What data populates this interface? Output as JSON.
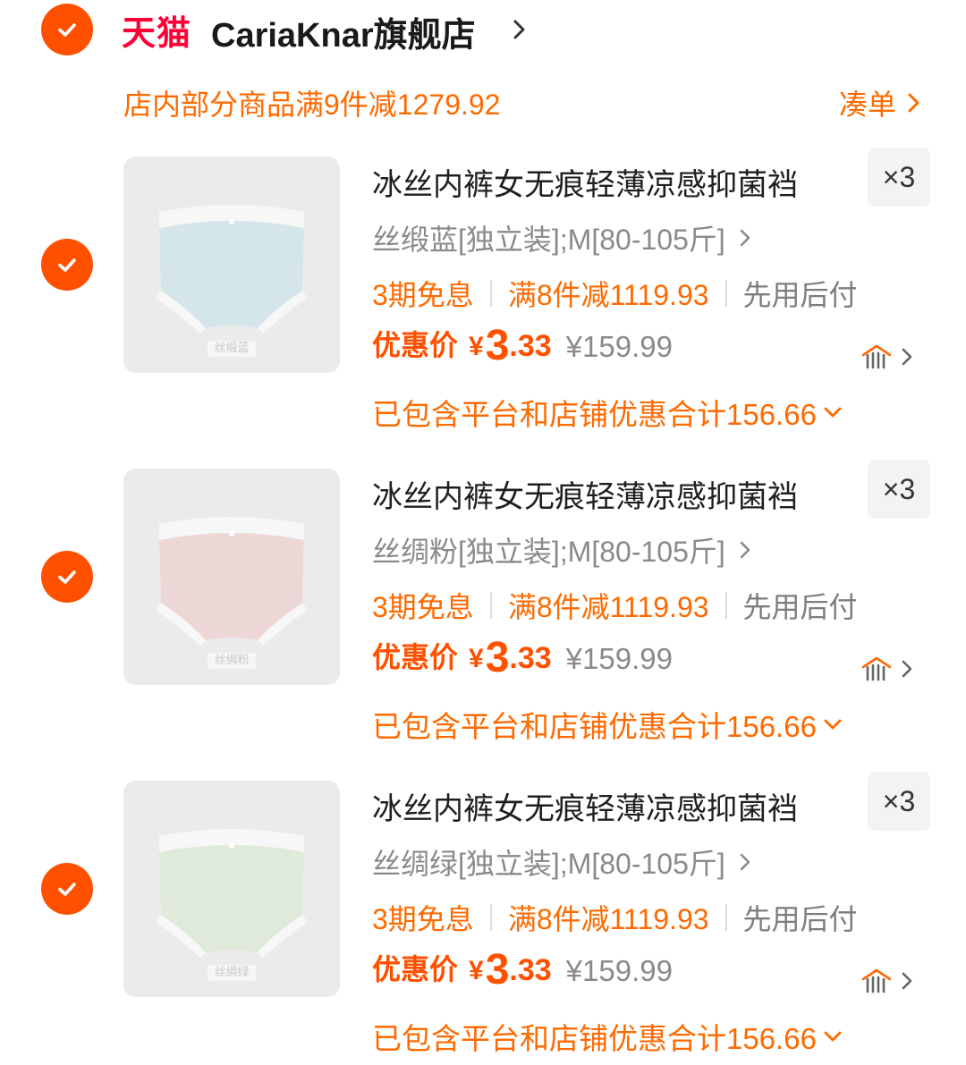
{
  "store": {
    "logo_text": "天猫",
    "name": "CariaKnar旗舰店",
    "promo": "店内部分商品满9件减1279.92",
    "coudan_label": "凑单"
  },
  "colors": {
    "accent": "#ff5000",
    "promo_orange": "#ff6a00",
    "tmall_red": "#ff0036",
    "gray_text": "#8a8a8a"
  },
  "items": [
    {
      "title": "冰丝内裤女无痕轻薄凉感抑菌裆",
      "quantity": "×3",
      "sku": "丝缎蓝[独立装];M[80-105斤]",
      "tags": [
        "3期免息",
        "满8件减1119.93",
        "先用后付"
      ],
      "price_label": "优惠价",
      "currency": "¥",
      "price_int": "3",
      "price_dec": ".33",
      "original_price": "¥159.99",
      "discount_note": "已包含平台和店铺优惠合计156.66",
      "image_label": "丝缎蓝",
      "image_color": "#d4e6ea",
      "checked": true
    },
    {
      "title": "冰丝内裤女无痕轻薄凉感抑菌裆",
      "quantity": "×3",
      "sku": "丝绸粉[独立装];M[80-105斤]",
      "tags": [
        "3期免息",
        "满8件减1119.93",
        "先用后付"
      ],
      "price_label": "优惠价",
      "currency": "¥",
      "price_int": "3",
      "price_dec": ".33",
      "original_price": "¥159.99",
      "discount_note": "已包含平台和店铺优惠合计156.66",
      "image_label": "丝绸粉",
      "image_color": "#ecd7d6",
      "checked": true
    },
    {
      "title": "冰丝内裤女无痕轻薄凉感抑菌裆",
      "quantity": "×3",
      "sku": "丝绸绿[独立装];M[80-105斤]",
      "tags": [
        "3期免息",
        "满8件减1119.93",
        "先用后付"
      ],
      "price_label": "优惠价",
      "currency": "¥",
      "price_int": "3",
      "price_dec": ".33",
      "original_price": "¥159.99",
      "discount_note": "已包含平台和店铺优惠合计156.66",
      "image_label": "丝绸绿",
      "image_color": "#dfeadb",
      "checked": true
    }
  ]
}
